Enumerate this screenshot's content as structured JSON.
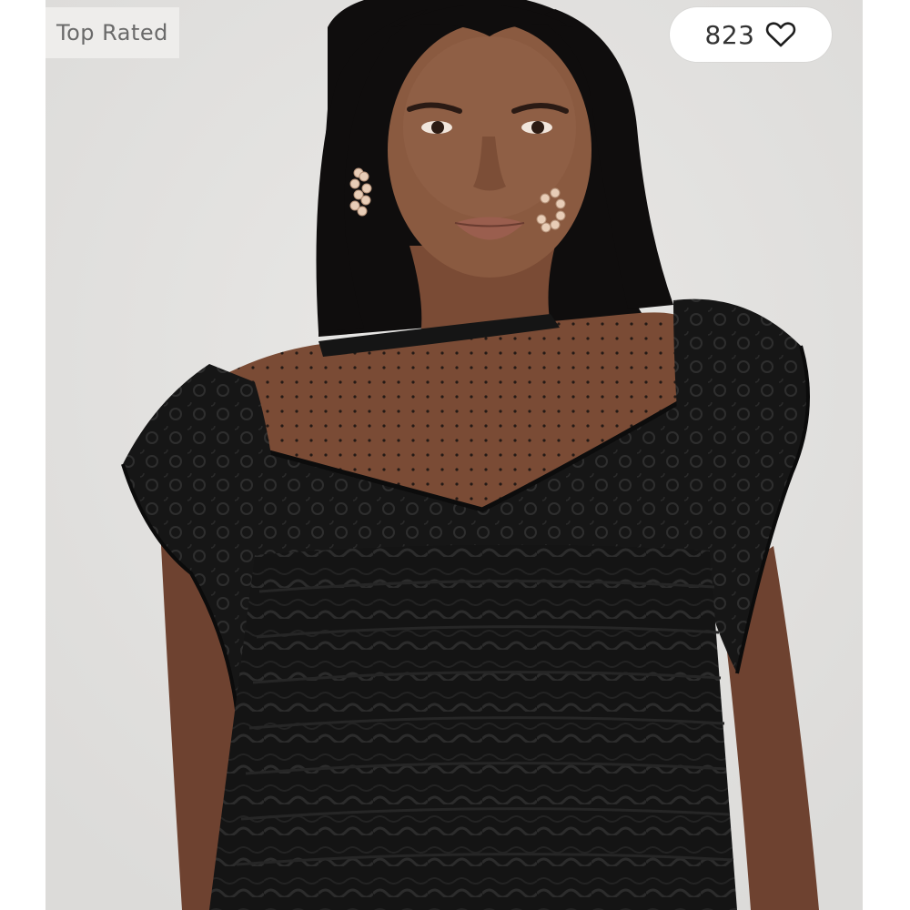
{
  "badge": {
    "label": "Top Rated"
  },
  "likes": {
    "count": "823",
    "icon": "heart-outline-icon"
  },
  "product_image": {
    "alt": ""
  },
  "colors": {
    "background": "#e4e3e1",
    "badge_bg": "#eeedeb",
    "badge_text": "#6a6a6a",
    "pill_bg": "#ffffff",
    "pill_text": "#333333",
    "garment": "#111111"
  }
}
